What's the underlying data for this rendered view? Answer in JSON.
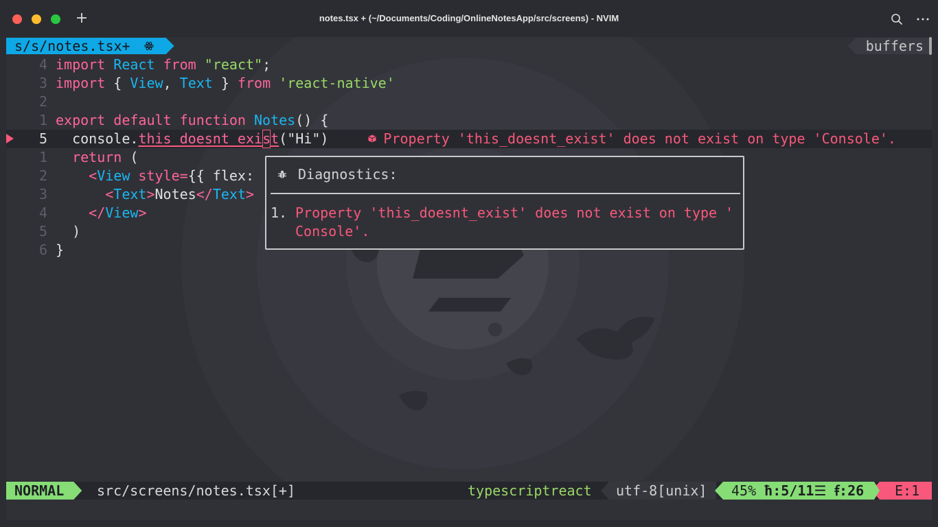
{
  "window": {
    "title": "notes.tsx + (~/Documents/Coding/OnlineNotesApp/src/screens) - NVIM",
    "new_tab_label": "+"
  },
  "tabline": {
    "active_tab": "s/s/notes.tsx+",
    "active_tab_icon": "react-icon",
    "buffers_label": "buffers"
  },
  "editor": {
    "lines": [
      {
        "num": "4",
        "text": "import React from \"react\";"
      },
      {
        "num": "3",
        "text": "import { View, Text } from 'react-native'"
      },
      {
        "num": "2",
        "text": ""
      },
      {
        "num": "1",
        "text": "export default function Notes() {"
      },
      {
        "num": "5",
        "text": "  console.this_doesnt_exist(\"Hi\")",
        "current": true,
        "error": true
      },
      {
        "num": "1",
        "text": "  return ("
      },
      {
        "num": "2",
        "text": "    <View style={{ flex: "
      },
      {
        "num": "3",
        "text": "      <Text>Notes</Text>"
      },
      {
        "num": "4",
        "text": "    </View>"
      },
      {
        "num": "5",
        "text": "  )"
      },
      {
        "num": "6",
        "text": "}"
      }
    ],
    "tokens": {
      "import": "import",
      "from": "from",
      "export": "export",
      "default": "default",
      "function": "function",
      "return": "return",
      "react_id": "React",
      "react_str": "\"react\"",
      "semicolon": ";",
      "brace_open": "{ ",
      "view_id": "View",
      "comma": ", ",
      "text_id": "Text",
      "brace_close": " }",
      "react_native_str": "'react-native'",
      "notes_fn": "Notes",
      "fn_tail": "() {",
      "console": "console",
      "dot": ".",
      "err_prefix": "this_doesnt_exi",
      "err_cursor_char": "s",
      "err_suffix": "t",
      "hi_args": "(\"Hi\")",
      "return_tail": " (",
      "lt": "<",
      "view_tag": "View",
      "style_attr": " style=",
      "style_val": "{{ flex: ",
      "gt": ">",
      "notes_text": "Notes",
      "lt_slash": "</",
      "text_tag": "Text",
      "close_paren": ")",
      "close_brace": "}"
    },
    "virtual_text": "Property 'this_doesnt_exist' does not exist on type 'Console'."
  },
  "diagnostics_float": {
    "title": "Diagnostics:",
    "item_number": "1.",
    "message": "Property 'this_doesnt_exist' does not exist on type '\nConsole'."
  },
  "statusline": {
    "mode": "NORMAL",
    "filename": "src/screens/notes.tsx[+]",
    "filetype": "typescriptreact",
    "encoding": "utf-8[unix]",
    "percent": "45%",
    "line_info": ":5/11",
    "col_info": ":26",
    "errors": "E:1"
  },
  "colors": {
    "accent_blue": "#0fa8e6",
    "keyword_pink": "#ff6597",
    "identifier_blue": "#1bb6f0",
    "string_green": "#99d868",
    "error_red": "#f8587b",
    "mode_green": "#86dd76",
    "background": "#303137"
  }
}
